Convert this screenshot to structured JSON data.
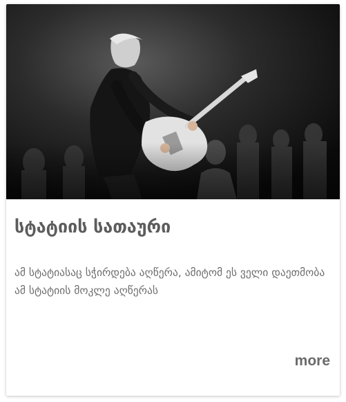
{
  "card": {
    "image_alt": "concert guitarist",
    "title": "სტატიის სათაური",
    "description": "ამ სტატიასაც სჭირდება აღწერა, ამიტომ ეს ველი დაეთმობა ამ სტატიის მოკლე აღწერას",
    "more_label": "more"
  }
}
